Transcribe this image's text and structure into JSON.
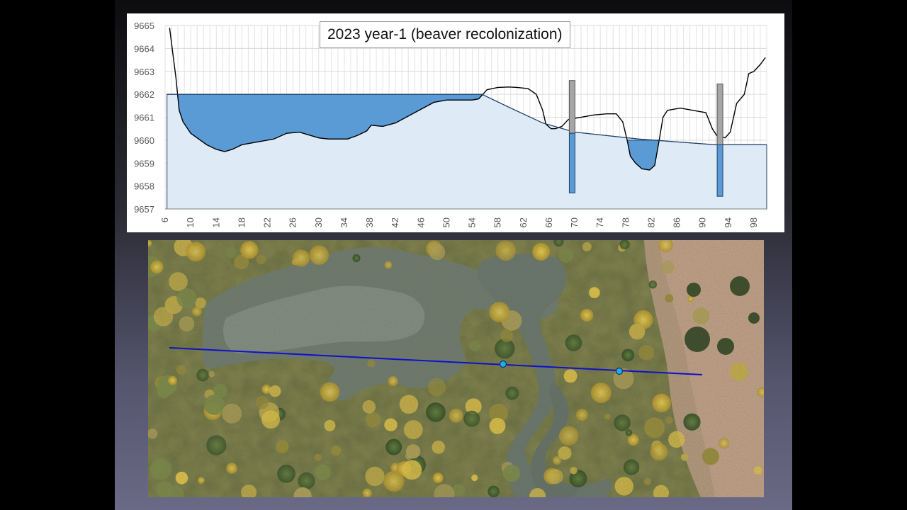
{
  "slide": {
    "title": "2023 year-1 (beaver recolonization)"
  },
  "chart_data": {
    "type": "area",
    "title": "2023 year-1 (beaver recolonization)",
    "xlabel": "",
    "ylabel": "",
    "xlim": [
      6,
      100
    ],
    "ylim": [
      9657,
      9665
    ],
    "x_ticks": [
      6,
      10,
      14,
      18,
      22,
      26,
      30,
      34,
      38,
      42,
      46,
      50,
      54,
      58,
      62,
      66,
      70,
      74,
      78,
      82,
      86,
      90,
      94,
      98
    ],
    "y_ticks": [
      9657,
      9658,
      9659,
      9660,
      9661,
      9662,
      9663,
      9664,
      9665
    ],
    "grid": true,
    "colors": {
      "pond": "#5b9bd5",
      "groundwater": "#deebf7",
      "profile_line": "#000000",
      "piezometer_above": "#a6a6a6",
      "piezometer_below": "#5b9bd5"
    },
    "series": [
      {
        "values": [
          [
            6.7,
            9664.9
          ],
          [
            7.7,
            9662.7
          ],
          [
            8.2,
            9661.3
          ],
          [
            8.8,
            9660.8
          ],
          [
            10,
            9660.3
          ],
          [
            12.5,
            9659.8
          ],
          [
            14,
            9659.6
          ],
          [
            15.3,
            9659.5
          ],
          [
            16.5,
            9659.6
          ],
          [
            18,
            9659.8
          ],
          [
            20,
            9659.9
          ],
          [
            23,
            9660.05
          ],
          [
            25,
            9660.3
          ],
          [
            27,
            9660.35
          ],
          [
            30,
            9660.1
          ],
          [
            31.5,
            9660.05
          ],
          [
            34.5,
            9660.05
          ],
          [
            36,
            9660.2
          ],
          [
            37.5,
            9660.4
          ],
          [
            38.2,
            9660.65
          ],
          [
            40,
            9660.6
          ],
          [
            42,
            9660.75
          ],
          [
            45,
            9661.2
          ],
          [
            48,
            9661.65
          ],
          [
            50,
            9661.75
          ],
          [
            54,
            9661.75
          ],
          [
            55,
            9661.8
          ],
          [
            56.3,
            9662.2
          ],
          [
            58,
            9662.3
          ],
          [
            59.7,
            9662.32
          ],
          [
            61,
            9662.3
          ],
          [
            62.7,
            9662.25
          ],
          [
            64,
            9662.0
          ],
          [
            65,
            9661.3
          ],
          [
            65.5,
            9660.7
          ],
          [
            66.3,
            9660.5
          ],
          [
            67,
            9660.5
          ],
          [
            68,
            9660.6
          ],
          [
            69,
            9660.9
          ],
          [
            70,
            9660.95
          ],
          [
            72,
            9661.05
          ],
          [
            73,
            9661.1
          ],
          [
            75,
            9661.15
          ],
          [
            76.5,
            9661.15
          ],
          [
            77.5,
            9660.8
          ],
          [
            78.2,
            9660.0
          ],
          [
            78.7,
            9659.3
          ],
          [
            79.5,
            9659.0
          ],
          [
            80.5,
            9658.75
          ],
          [
            81.7,
            9658.7
          ],
          [
            82.5,
            9658.9
          ],
          [
            83.2,
            9660.0
          ],
          [
            83.8,
            9661.0
          ],
          [
            84.5,
            9661.3
          ],
          [
            86.5,
            9661.4
          ],
          [
            88.5,
            9661.3
          ],
          [
            90.5,
            9661.2
          ],
          [
            91.5,
            9660.5
          ],
          [
            92.2,
            9660.2
          ],
          [
            93.5,
            9660.1
          ],
          [
            94.3,
            9660.35
          ],
          [
            95.3,
            9661.6
          ],
          [
            96.5,
            9662.0
          ],
          [
            97.2,
            9662.9
          ],
          [
            98,
            9663.0
          ],
          [
            99,
            9663.3
          ],
          [
            99.8,
            9663.6
          ]
        ]
      },
      {
        "values": [
          [
            6.3,
            9662.0
          ],
          [
            55.5,
            9662.0
          ],
          [
            60,
            9661.4
          ],
          [
            65,
            9660.75
          ],
          [
            70,
            9660.35
          ],
          [
            80,
            9660.05
          ],
          [
            92,
            9659.8
          ],
          [
            100,
            9659.8
          ]
        ]
      }
    ],
    "pond_regions": [
      {
        "x_from": 6.3,
        "x_to": 55.5,
        "surface": 9662.0
      },
      {
        "x_from": 78.2,
        "x_to": 83.2,
        "surface": 9660.0
      }
    ],
    "piezometers": [
      {
        "x": 69.6,
        "top": 9662.6,
        "water": 9660.3,
        "bottom": 9657.7
      },
      {
        "x": 92.7,
        "top": 9662.45,
        "water": 9659.8,
        "bottom": 9657.55
      }
    ]
  },
  "aerial_photo": {
    "transect_line_color": "#1010c8",
    "marker_color": "#2aa8e8",
    "markers_count": 2
  }
}
